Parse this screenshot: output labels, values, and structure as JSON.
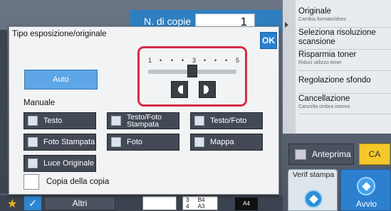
{
  "header": {
    "copies_label": "N. di copie",
    "copies_value": "1"
  },
  "right_panel": {
    "items": [
      {
        "title": "Originale",
        "sub": "Cambia formato/direz."
      },
      {
        "title": "Seleziona risoluzione scansione",
        "sub": ""
      },
      {
        "title": "Risparmia toner",
        "sub": "Riduci utilizzo toner"
      },
      {
        "title": "Regolazione sfondo",
        "sub": ""
      },
      {
        "title": "Cancellazione",
        "sub": "Cancella ombra intorno"
      }
    ]
  },
  "actions": {
    "preview_label": "Anteprima",
    "ca_label": "CA",
    "verify_label": "Verif stampa",
    "start_label": "Avvio"
  },
  "bottom": {
    "others_label": "Altri",
    "tray1_num": "3",
    "tray1_size": "B4",
    "tray2_num": "4",
    "tray2_size": "A3",
    "paper_size": "A4"
  },
  "dialog": {
    "title": "Tipo esposizione/originale",
    "ok_label": "OK",
    "auto_label": "Auto",
    "manual_label": "Manuale",
    "scale_labels": [
      "1",
      "3",
      "5"
    ],
    "exposure_level": 3,
    "exposure_max": 5,
    "modes": [
      {
        "label": "Testo",
        "icon": "text-doc-icon"
      },
      {
        "label": "Testo/Foto Stampata",
        "icon": "text-printed-photo-icon"
      },
      {
        "label": "Testo/Foto",
        "icon": "text-photo-icon"
      },
      {
        "label": "Foto Stampata",
        "icon": "printed-photo-icon"
      },
      {
        "label": "Foto",
        "icon": "photo-icon"
      },
      {
        "label": "Mappa",
        "icon": "map-icon"
      },
      {
        "label": "Luce Originale",
        "icon": "light-original-icon"
      }
    ],
    "copy_of_copy_label": "Copia della copia"
  },
  "colors": {
    "accent": "#2a81cf",
    "highlight": "#d52d48",
    "ca": "#f4c82a"
  }
}
